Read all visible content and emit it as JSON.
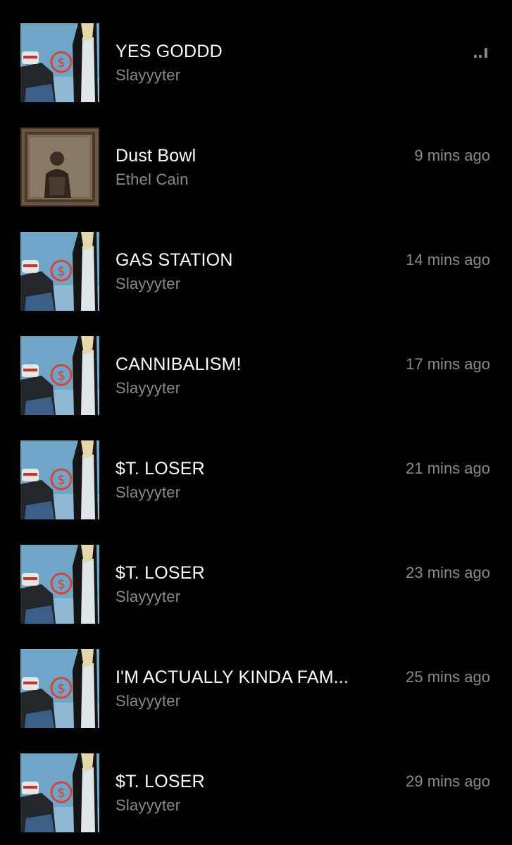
{
  "tracks": [
    {
      "title": "YES GODDD",
      "artist": "Slayyyter",
      "time": "",
      "now_playing": true,
      "artwork": "slayyyter-cover"
    },
    {
      "title": "Dust Bowl",
      "artist": "Ethel Cain",
      "time": "9 mins ago",
      "now_playing": false,
      "artwork": "ethel-cain-cover"
    },
    {
      "title": "GAS STATION",
      "artist": "Slayyyter",
      "time": "14 mins ago",
      "now_playing": false,
      "artwork": "slayyyter-cover"
    },
    {
      "title": "CANNIBALISM!",
      "artist": "Slayyyter",
      "time": "17 mins ago",
      "now_playing": false,
      "artwork": "slayyyter-cover"
    },
    {
      "title": "$T. LOSER",
      "artist": "Slayyyter",
      "time": "21 mins ago",
      "now_playing": false,
      "artwork": "slayyyter-cover"
    },
    {
      "title": "$T. LOSER",
      "artist": "Slayyyter",
      "time": "23 mins ago",
      "now_playing": false,
      "artwork": "slayyyter-cover"
    },
    {
      "title": "I'M ACTUALLY KINDA FAM...",
      "artist": "Slayyyter",
      "time": "25 mins ago",
      "now_playing": false,
      "artwork": "slayyyter-cover"
    },
    {
      "title": "$T. LOSER",
      "artist": "Slayyyter",
      "time": "29 mins ago",
      "now_playing": false,
      "artwork": "slayyyter-cover"
    }
  ],
  "colors": {
    "background": "#000000",
    "title": "#ffffff",
    "secondary": "#8a8a8e",
    "sky": "#6fa6c8",
    "emblem_red": "#d6453a"
  }
}
